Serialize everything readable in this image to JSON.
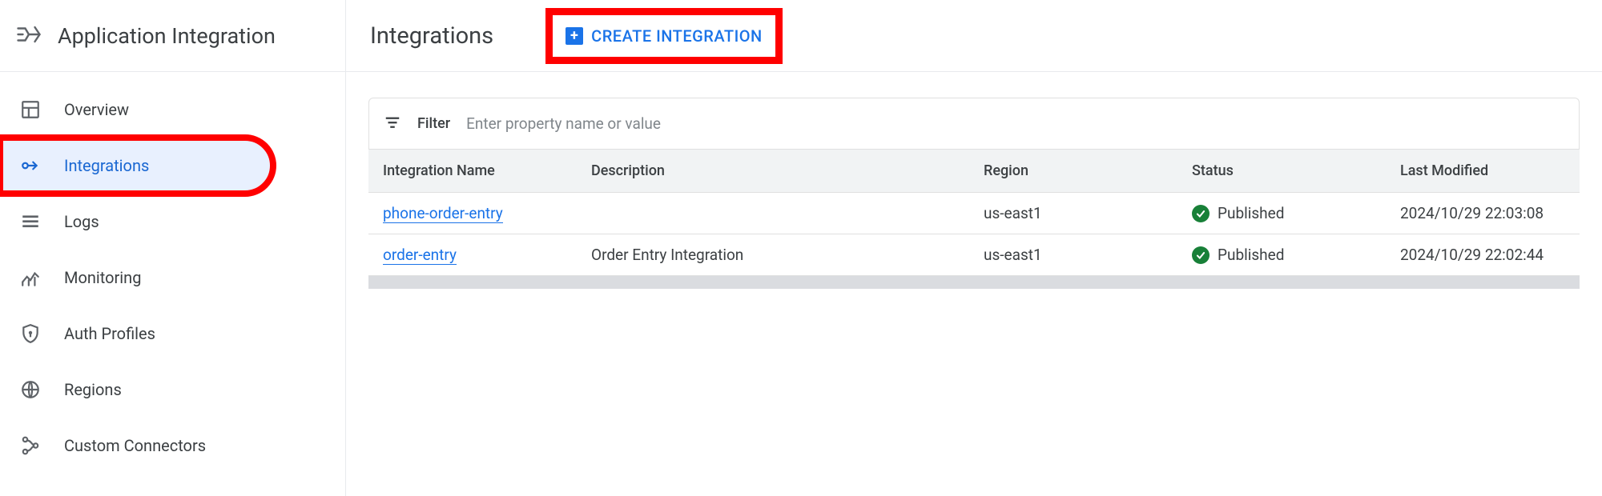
{
  "product": {
    "title": "Application Integration"
  },
  "sidebar": {
    "items": [
      {
        "label": "Overview"
      },
      {
        "label": "Integrations"
      },
      {
        "label": "Logs"
      },
      {
        "label": "Monitoring"
      },
      {
        "label": "Auth Profiles"
      },
      {
        "label": "Regions"
      },
      {
        "label": "Custom Connectors"
      }
    ]
  },
  "header": {
    "title": "Integrations",
    "create_label": "CREATE INTEGRATION"
  },
  "filter": {
    "label": "Filter",
    "placeholder": "Enter property name or value"
  },
  "table": {
    "columns": {
      "name": "Integration Name",
      "description": "Description",
      "region": "Region",
      "status": "Status",
      "last_modified": "Last Modified"
    },
    "rows": [
      {
        "name": "phone-order-entry",
        "description": "",
        "region": "us-east1",
        "status": "Published",
        "last_modified": "2024/10/29 22:03:08"
      },
      {
        "name": "order-entry",
        "description": "Order Entry Integration",
        "region": "us-east1",
        "status": "Published",
        "last_modified": "2024/10/29 22:02:44"
      }
    ]
  }
}
